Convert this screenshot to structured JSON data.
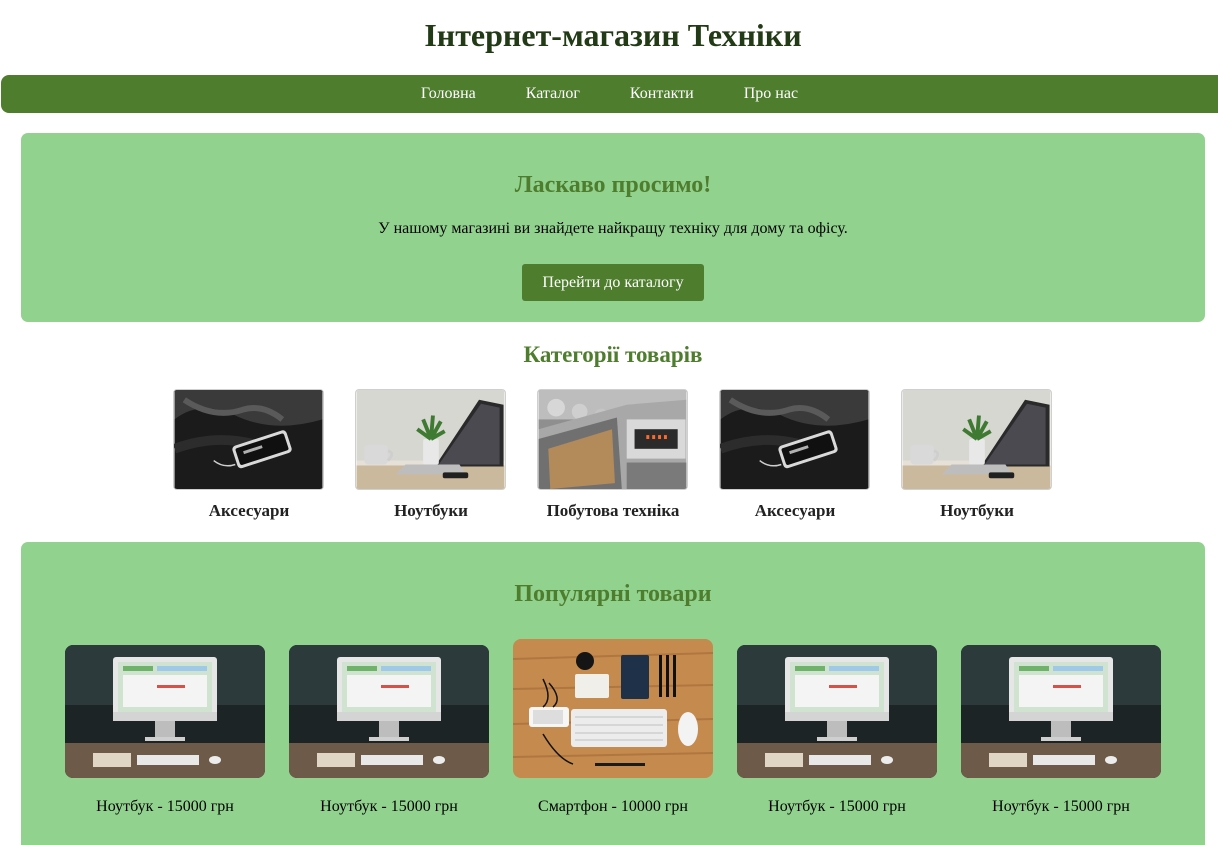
{
  "header": {
    "title": "Інтернет-магазин Техніки"
  },
  "nav": {
    "items": [
      {
        "label": "Головна"
      },
      {
        "label": "Каталог"
      },
      {
        "label": "Контакти"
      },
      {
        "label": "Про нас"
      }
    ]
  },
  "welcome": {
    "title": "Ласкаво просимо!",
    "text": "У нашому магазині ви знайдете найкращу техніку для дому та офісу.",
    "button_label": "Перейти до каталогу"
  },
  "categories": {
    "heading": "Категорії товарів",
    "items": [
      {
        "label": "Аксесуари",
        "image": "phone-on-dark-surface"
      },
      {
        "label": "Ноутбуки",
        "image": "laptop-on-desk"
      },
      {
        "label": "Побутова техніка",
        "image": "kitchen-oven"
      },
      {
        "label": "Аксесуари",
        "image": "phone-on-dark-surface"
      },
      {
        "label": "Ноутбуки",
        "image": "laptop-on-desk"
      }
    ]
  },
  "popular": {
    "title": "Популярні товари",
    "items": [
      {
        "label": "Ноутбук - 15000 грн",
        "image": "imac-desk"
      },
      {
        "label": "Ноутбук - 15000 грн",
        "image": "imac-desk"
      },
      {
        "label": "Смартфон - 10000 грн",
        "image": "flatlay-keyboard-phone"
      },
      {
        "label": "Ноутбук - 15000 грн",
        "image": "imac-desk"
      },
      {
        "label": "Ноутбук - 15000 грн",
        "image": "imac-desk"
      }
    ]
  },
  "colors": {
    "nav_bg": "#4e7d2e",
    "section_bg": "#92d28f",
    "heading_green": "#4e7d2e",
    "title_dark": "#223a15"
  }
}
